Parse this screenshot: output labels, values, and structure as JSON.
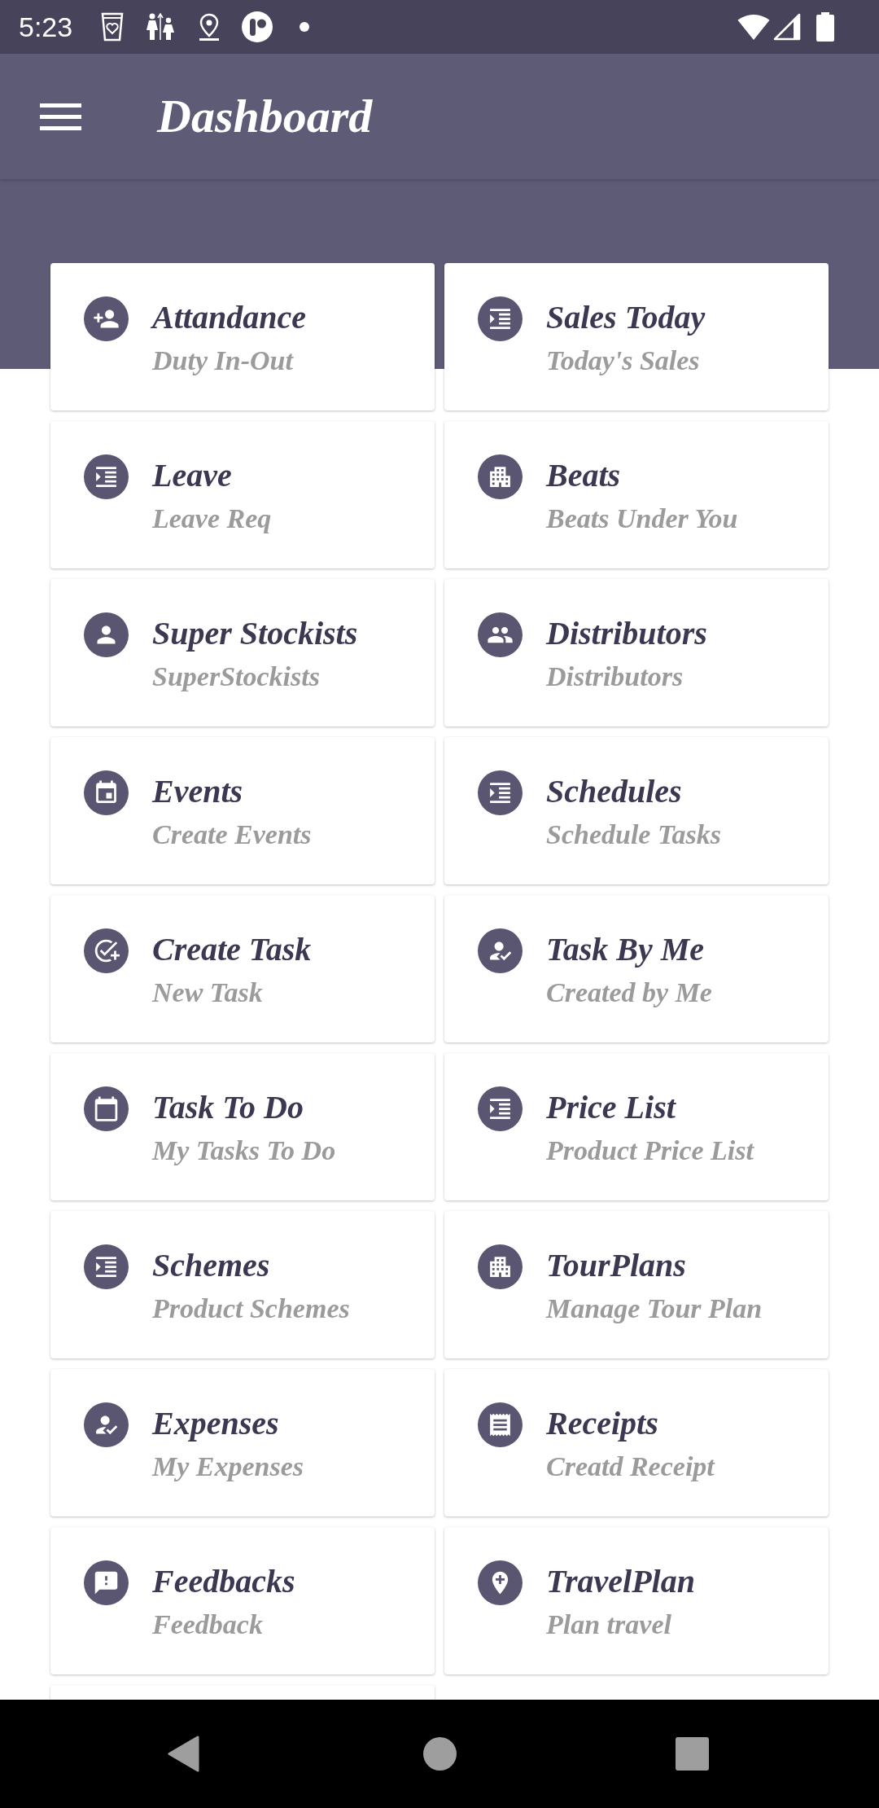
{
  "status_bar": {
    "time": "5:23"
  },
  "app_bar": {
    "title": "Dashboard"
  },
  "tiles": [
    {
      "title": "Attandance",
      "subtitle": "Duty In-Out"
    },
    {
      "title": "Sales Today",
      "subtitle": "Today's Sales"
    },
    {
      "title": "Leave",
      "subtitle": "Leave Req"
    },
    {
      "title": "Beats",
      "subtitle": "Beats Under You"
    },
    {
      "title": "Super Stockists",
      "subtitle": "SuperStockists"
    },
    {
      "title": "Distributors",
      "subtitle": "Distributors"
    },
    {
      "title": "Events",
      "subtitle": "Create Events"
    },
    {
      "title": "Schedules",
      "subtitle": "Schedule Tasks"
    },
    {
      "title": "Create Task",
      "subtitle": "New Task"
    },
    {
      "title": "Task By Me",
      "subtitle": "Created by Me"
    },
    {
      "title": "Task To Do",
      "subtitle": "My Tasks To Do"
    },
    {
      "title": "Price List",
      "subtitle": "Product Price List"
    },
    {
      "title": "Schemes",
      "subtitle": "Product Schemes"
    },
    {
      "title": "TourPlans",
      "subtitle": "Manage Tour Plan"
    },
    {
      "title": "Expenses",
      "subtitle": "My Expenses"
    },
    {
      "title": "Receipts",
      "subtitle": "Creatd Receipt"
    },
    {
      "title": "Feedbacks",
      "subtitle": "Feedback"
    },
    {
      "title": "TravelPlan",
      "subtitle": "Plan travel"
    }
  ]
}
